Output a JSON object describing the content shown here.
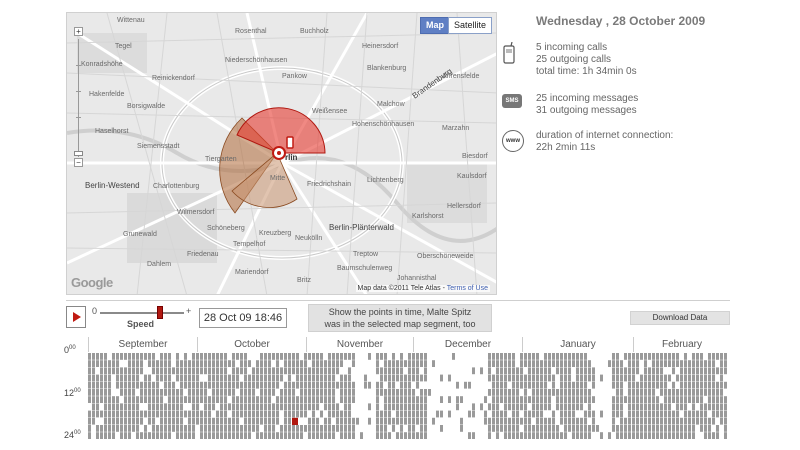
{
  "map": {
    "type_buttons": {
      "map": "Map",
      "satellite": "Satellite"
    },
    "zoom": {
      "in": "+",
      "out": "−"
    },
    "logo": "Google",
    "credit": "Map data ©2011 Tele Atlas",
    "terms": "Terms of Use",
    "labels": [
      "Wittenau",
      "Rosenthal",
      "Buchholz",
      "Heinersdorf",
      "Niederschönhausen",
      "Reinickendorf",
      "Tegel",
      "Konradshöhe",
      "Haselhorst",
      "Pankow",
      "Blankenburg",
      "Malchow",
      "Brandenburg",
      "Ahrensfelde",
      "Borsigwalde",
      "Kaulsdorf",
      "Weißensee",
      "Hohenschönhausen",
      "Marzahn",
      "Berlin-Westend",
      "Tiergarten",
      "Charlottenburg",
      "Friedrichshain",
      "Lichtenberg",
      "Biesdorf",
      "Mitte",
      "Kreuzberg",
      "Schöneberg",
      "Neukölln",
      "Berlin-Plänterwald",
      "Grunewald",
      "Tempelhof",
      "Treptow",
      "Johannisthal",
      "Baumschulenweg",
      "Dahlem",
      "Britz",
      "Mariendorf",
      "Oberschöneweide",
      "Karlshorst",
      "Hellersdorf",
      "Hakenfelde",
      "Siemensstadt",
      "Friedenau",
      "Wilmersdorf"
    ],
    "city_label": "rlin"
  },
  "info": {
    "date": "Wednesday , 28 October 2009",
    "calls": {
      "icon": "phone-icon",
      "incoming": "5 incoming calls",
      "outgoing": "25 outgoing calls",
      "total": "total time: 1h 34min 0s"
    },
    "sms": {
      "icon": "sms-icon",
      "icon_text": "SMS",
      "incoming": "25 incoming messages",
      "outgoing": "31 outgoing messages"
    },
    "internet": {
      "icon": "www-icon",
      "icon_text": "www",
      "label": "duration of internet connection:",
      "duration": "22h 2min 11s"
    }
  },
  "controls": {
    "speed_min": "0",
    "speed_max": "+",
    "speed_label": "Speed",
    "speed_level": 0.72,
    "datetime": "28 Oct 09 18:46",
    "show_points_line1": "Show the points in time, Malte Spitz",
    "show_points_line2": "was in the selected map segment, too",
    "download": "Download Data"
  },
  "timeline": {
    "months": [
      "September",
      "October",
      "November",
      "December",
      "January",
      "February"
    ],
    "hour_labels": [
      {
        "value": "0",
        "sup": "00"
      },
      {
        "value": "12",
        "sup": "00"
      },
      {
        "value": "24",
        "sup": "00"
      }
    ],
    "colors": {
      "activity": "#9a9a9a",
      "selected": "#b01810",
      "empty": "#ffffff"
    }
  },
  "colors": {
    "accent": "#c01a12",
    "map_button": "#5f7fc4",
    "sector_red": "#e63a30",
    "sector_brown": "#b06a38"
  }
}
